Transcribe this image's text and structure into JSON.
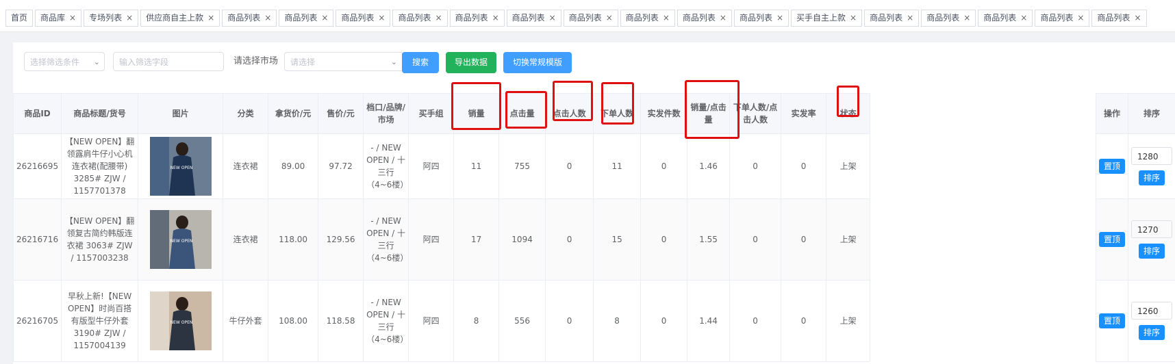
{
  "tabs": [
    {
      "label": "首页",
      "closable": false
    },
    {
      "label": "商品库",
      "closable": true
    },
    {
      "label": "专场列表",
      "closable": true
    },
    {
      "label": "供应商自主上款",
      "closable": true
    },
    {
      "label": "商品列表",
      "closable": true
    },
    {
      "label": "商品列表",
      "closable": true
    },
    {
      "label": "商品列表",
      "closable": true
    },
    {
      "label": "商品列表",
      "closable": true
    },
    {
      "label": "商品列表",
      "closable": true
    },
    {
      "label": "商品列表",
      "closable": true
    },
    {
      "label": "商品列表",
      "closable": true
    },
    {
      "label": "商品列表",
      "closable": true
    },
    {
      "label": "商品列表",
      "closable": true
    },
    {
      "label": "商品列表",
      "closable": true
    },
    {
      "label": "买手自主上款",
      "closable": true
    },
    {
      "label": "商品列表",
      "closable": true
    },
    {
      "label": "商品列表",
      "closable": true
    },
    {
      "label": "商品列表",
      "closable": true
    },
    {
      "label": "商品列表",
      "closable": true
    },
    {
      "label": "商品列表",
      "closable": true
    }
  ],
  "filters": {
    "condition_placeholder": "选择筛选条件",
    "field_placeholder": "输入筛选字段",
    "market_label": "请选择市场",
    "market_placeholder": "请选择",
    "search_label": "搜索",
    "export_label": "导出数据",
    "switch_label": "切换常规模版"
  },
  "table": {
    "headers": [
      "商品ID",
      "商品标题/货号",
      "图片",
      "分类",
      "拿货价/元",
      "售价/元",
      "档口/品牌/市场",
      "买手组",
      "销量",
      "点击量",
      "点击人数",
      "下单人数",
      "实发件数",
      "销量/点击量",
      "下单人数/点击人数",
      "实发率",
      "状态"
    ],
    "fixed_headers": [
      "操作",
      "排序"
    ],
    "rows": [
      {
        "id": "26216695",
        "title": "【NEW OPEN】翻领露肩牛仔小心机连衣裙(配腰带) 3285# ZJW / 1157701378",
        "category": "连衣裙",
        "cost": "89.00",
        "price": "97.72",
        "stall": "- / NEW OPEN / 十三行（4~6楼）",
        "group": "阿四",
        "sales": "11",
        "clicks": "755",
        "clickers": "0",
        "orders": "11",
        "shipped": "0",
        "ratio": "1.46",
        "order_ratio": "0",
        "ship_rate": "0",
        "status": "上架",
        "op": "置顶",
        "sort_value": "1280",
        "sort_btn": "排序"
      },
      {
        "id": "26216716",
        "title": "【NEW OPEN】翻领复古简约韩版连衣裙 3063# ZJW / 1157003238",
        "category": "连衣裙",
        "cost": "118.00",
        "price": "129.56",
        "stall": "- / NEW OPEN / 十三行（4~6楼）",
        "group": "阿四",
        "sales": "17",
        "clicks": "1094",
        "clickers": "0",
        "orders": "15",
        "shipped": "0",
        "ratio": "1.55",
        "order_ratio": "0",
        "ship_rate": "0",
        "status": "上架",
        "op": "置顶",
        "sort_value": "1270",
        "sort_btn": "排序"
      },
      {
        "id": "26216705",
        "title": "早秋上新!【NEW OPEN】时尚百搭有版型牛仔外套 3190# ZJW / 1157004139",
        "category": "牛仔外套",
        "cost": "108.00",
        "price": "118.58",
        "stall": "- / NEW OPEN / 十三行（4~6楼）",
        "group": "阿四",
        "sales": "8",
        "clicks": "556",
        "clickers": "0",
        "orders": "8",
        "shipped": "0",
        "ratio": "1.44",
        "order_ratio": "0",
        "ship_rate": "0",
        "status": "上架",
        "op": "置顶",
        "sort_value": "1260",
        "sort_btn": "排序"
      }
    ]
  },
  "colors": {
    "primary": "#409eff",
    "success": "#21b25b",
    "highlight": "#e01010"
  },
  "product_image_text": "NEW OPEN"
}
